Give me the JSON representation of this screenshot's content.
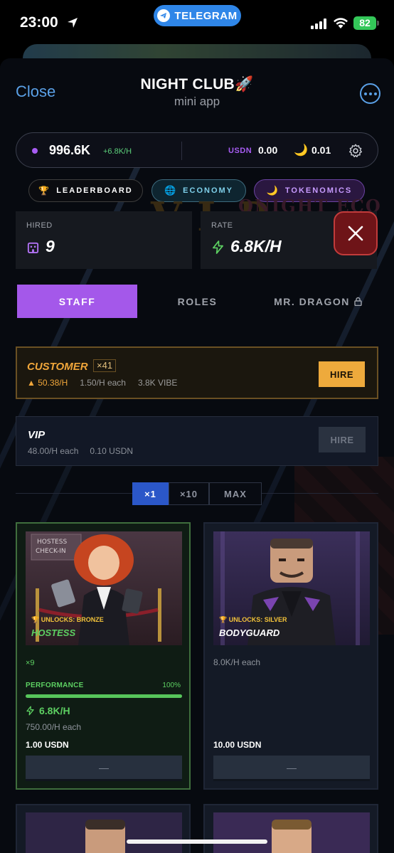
{
  "status_bar": {
    "time": "23:00",
    "banner": "TELEGRAM",
    "battery": "82"
  },
  "header": {
    "close": "Close",
    "title": "NIGHT CLUB🚀",
    "subtitle": "mini app"
  },
  "balance": {
    "value": "996.6K",
    "rate": "+6.8K/H",
    "usdn_label": "USDN",
    "usdn_value": "0.00",
    "moon_value": "0.01"
  },
  "nav_pills": {
    "leaderboard": "LEADERBOARD",
    "economy": "ECONOMY",
    "tokenomics": "TOKENOMICS"
  },
  "background_text": {
    "vip": "V.I.P",
    "night": "ONIGHT ECO"
  },
  "stats": {
    "hired_label": "HIRED",
    "hired_value": "9",
    "rate_label": "RATE",
    "rate_value": "6.8K/H"
  },
  "tabs": {
    "staff": "STAFF",
    "roles": "ROLES",
    "dragon": "MR. DRAGON"
  },
  "customer": {
    "name": "CUSTOMER",
    "count": "×41",
    "rate": "▲ 50.38/H",
    "each": "1.50/H each",
    "price": "3.8K VIBE",
    "hire": "HIRE"
  },
  "vip_card": {
    "name": "VIP",
    "each": "48.00/H each",
    "price": "0.10 USDN",
    "hire": "HIRE"
  },
  "multipliers": [
    "×1",
    "×10",
    "MAX"
  ],
  "hostess": {
    "unlock": "🏆 UNLOCKS: BRONZE",
    "name": "HOSTESS",
    "count": "×9",
    "perf_label": "PERFORMANCE",
    "perf_value": "100%",
    "perf_fraction": 1.0,
    "rate": "6.8K/H",
    "each": "750.00/H each",
    "price": "1.00 USDN",
    "button": "—"
  },
  "bodyguard": {
    "unlock": "🏆 UNLOCKS: SILVER",
    "name": "BODYGUARD",
    "each": "8.0K/H each",
    "price": "10.00 USDN",
    "button": "—"
  },
  "hostess_sign": {
    "line1": "HOSTESS",
    "line2": "CHECK-IN"
  },
  "colors": {
    "accent_purple": "#a458ea",
    "link_blue": "#5aa0e6",
    "gold": "#eeaa3c",
    "green": "#5dd062"
  }
}
